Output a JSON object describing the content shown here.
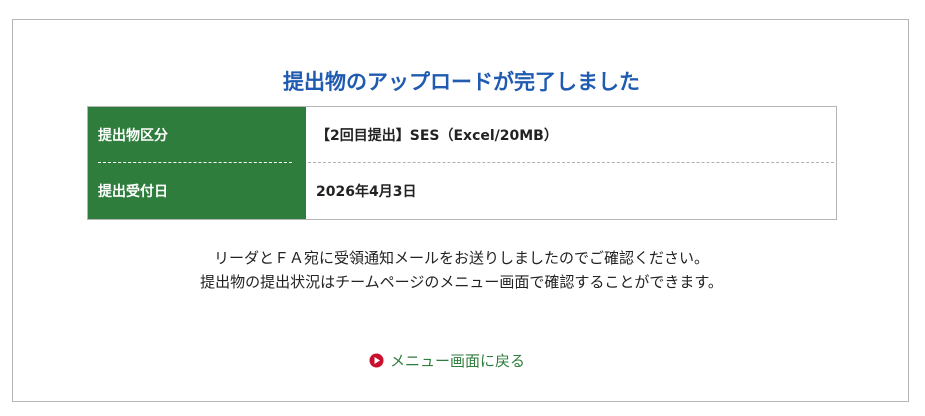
{
  "page": {
    "title": "提出物のアップロードが完了しました"
  },
  "details": [
    {
      "label": "提出物区分",
      "value": "【2回目提出】SES（Excel/20MB）"
    },
    {
      "label": "提出受付日",
      "value": "2026年4月3日"
    }
  ],
  "message": {
    "line1": "リーダとＦＡ宛に受領通知メールをお送りしましたのでご確認ください。",
    "line2": "提出物の提出状況はチームページのメニュー画面で確認することができます。"
  },
  "nav": {
    "back_label": "メニュー画面に戻る"
  },
  "colors": {
    "title": "#1f5bb0",
    "label_bg": "#2e7d3c",
    "link": "#2e7d3c",
    "arrow_icon": "#c8102e"
  }
}
